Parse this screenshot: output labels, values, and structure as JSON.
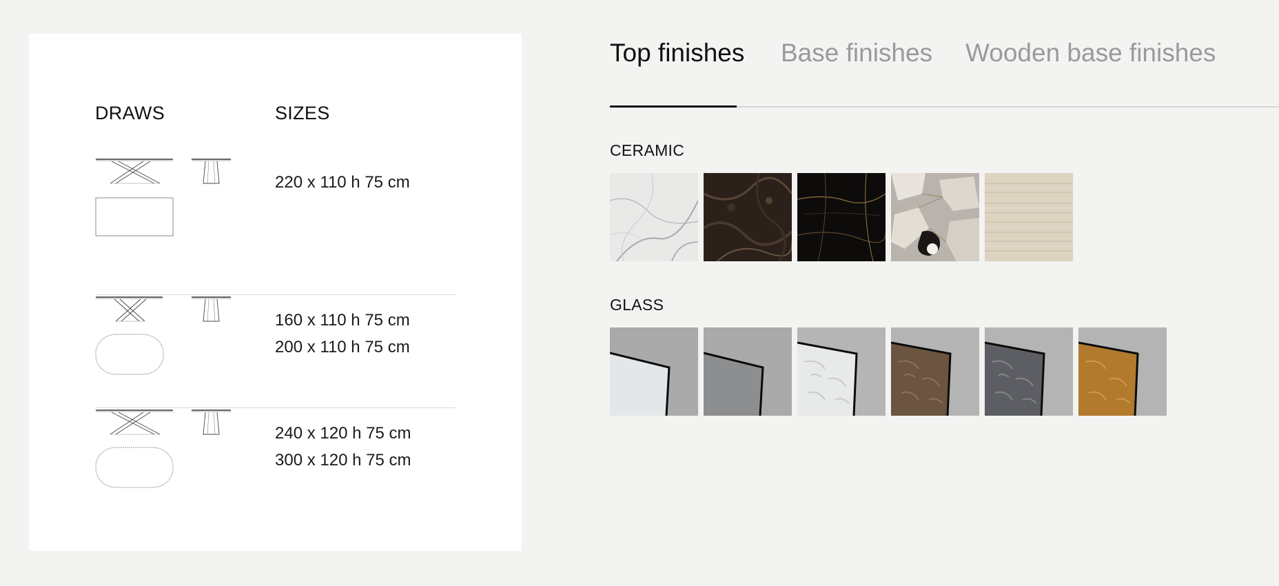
{
  "draws_panel": {
    "draws_heading": "DRAWS",
    "sizes_heading": "SIZES",
    "rows": [
      {
        "top_shape": "rectangle",
        "sizes": [
          "220 x 110 h 75 cm"
        ]
      },
      {
        "top_shape": "oval",
        "sizes": [
          "160 x 110 h 75 cm",
          "200 x 110 h 75 cm"
        ]
      },
      {
        "top_shape": "oval",
        "sizes": [
          "240 x 120 h 75 cm",
          "300 x 120 h 75 cm"
        ]
      }
    ]
  },
  "tabs": [
    {
      "label": "Top finishes",
      "active": true
    },
    {
      "label": "Base finishes",
      "active": false
    },
    {
      "label": "Wooden base finishes",
      "active": false
    }
  ],
  "finishes": {
    "ceramic": {
      "title": "CERAMIC",
      "swatches": [
        "white-marble",
        "dark-brown-marble",
        "black-gold-veined",
        "grey-patagonia",
        "beige-travertine"
      ]
    },
    "glass": {
      "title": "GLASS",
      "swatches": [
        "clear-glass",
        "grey-glass",
        "textured-white-glass",
        "textured-bronze-glass",
        "textured-smoke-glass",
        "amber-glass"
      ]
    }
  },
  "colors": {
    "page_background": "#f3f3f1",
    "card_background": "#ffffff",
    "tab_active": "#111111",
    "tab_inactive": "#9a9a9a",
    "glass_backdrop": "#a9aaa9"
  }
}
